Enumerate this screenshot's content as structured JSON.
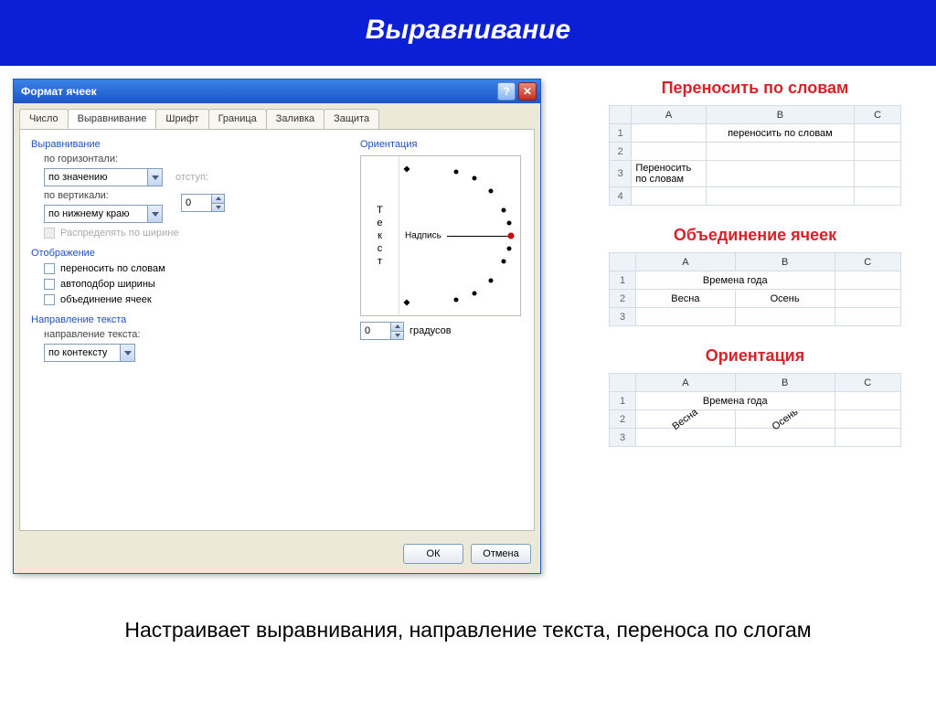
{
  "banner": "Выравнивание",
  "dialog": {
    "title": "Формат ячеек",
    "tabs": [
      "Число",
      "Выравнивание",
      "Шрифт",
      "Граница",
      "Заливка",
      "Защита"
    ],
    "active_tab_index": 1,
    "alignment": {
      "section": "Выравнивание",
      "horizontal_label": "по горизонтали:",
      "horizontal_value": "по значению",
      "indent_label": "отступ:",
      "indent_value": "0",
      "vertical_label": "по вертикали:",
      "vertical_value": "по нижнему краю",
      "distribute_label": "Распределять по ширине"
    },
    "display": {
      "section": "Отображение",
      "wrap": "переносить по словам",
      "shrink": "автоподбор ширины",
      "merge": "объединение ячеек"
    },
    "direction": {
      "section": "Направление текста",
      "label": "направление текста:",
      "value": "по контексту"
    },
    "orientation": {
      "section": "Ориентация",
      "vertical_text": "Текст",
      "inner_label": "Надпись",
      "degrees_value": "0",
      "degrees_label": "градусов"
    },
    "buttons": {
      "ok": "ОК",
      "cancel": "Отмена"
    }
  },
  "examples": {
    "wrap": {
      "title": "Переносить по словам",
      "cols": [
        "A",
        "B",
        "C"
      ],
      "rows": [
        {
          "n": "1",
          "b": "переносить по словам"
        },
        {
          "n": "2"
        },
        {
          "n": "3",
          "a": "Переносить по словам"
        },
        {
          "n": "4"
        }
      ]
    },
    "merge": {
      "title": "Объединение ячеек",
      "cols": [
        "A",
        "B",
        "C"
      ],
      "merged": "Времена года",
      "row2": {
        "a": "Весна",
        "b": "Осень"
      }
    },
    "orient": {
      "title": "Ориентация",
      "cols": [
        "A",
        "B",
        "C"
      ],
      "merged": "Времена года",
      "row2": {
        "a": "Весна",
        "b": "Осень"
      }
    }
  },
  "caption": "Настраивает выравнивания, направление текста, переноса по слогам"
}
